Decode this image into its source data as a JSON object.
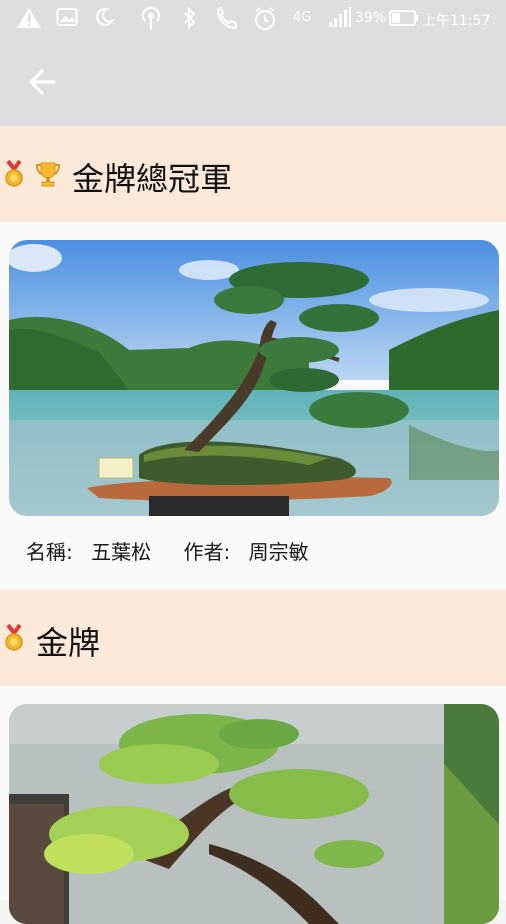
{
  "status_bar": {
    "battery_percent": "39%",
    "time": "上午11:57",
    "network": "4G",
    "icons": [
      "warning-icon",
      "image-icon",
      "moon-icon",
      "hotspot-icon",
      "bluetooth-icon",
      "call-icon",
      "alarm-icon",
      "network-4g-icon",
      "signal-icon",
      "battery-icon"
    ]
  },
  "app_bar": {
    "back_icon": "arrow-left-icon"
  },
  "sections": [
    {
      "title": "金牌總冠軍",
      "badges": [
        "medal-icon",
        "trophy-icon"
      ],
      "entry": {
        "name_label": "名稱:",
        "name": "五葉松",
        "author_label": "作者:",
        "author": "周宗敏"
      }
    },
    {
      "title": "金牌",
      "badges": [
        "medal-icon"
      ]
    }
  ],
  "colors": {
    "section_bg": "#fde9d9",
    "bar_bg": "#dedede",
    "card_bg": "#fafafa"
  }
}
